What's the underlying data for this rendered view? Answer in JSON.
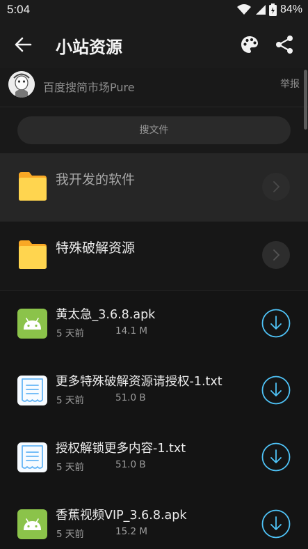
{
  "status_bar": {
    "time": "5:04",
    "battery": "84%"
  },
  "app_bar": {
    "title": "小站资源"
  },
  "owner": {
    "name": "百度搜简市场Pure",
    "report_label": "举报"
  },
  "search": {
    "label": "搜文件"
  },
  "folders": [
    {
      "name": "我开发的软件"
    },
    {
      "name": "特殊破解资源"
    }
  ],
  "files": [
    {
      "name": "黄太急_3.6.8.apk",
      "date": "5 天前",
      "size": "14.1 M",
      "type": "apk"
    },
    {
      "name": "更多特殊破解资源请授权-1.txt",
      "date": "5 天前",
      "size": "51.0 B",
      "type": "txt"
    },
    {
      "name": "授权解锁更多内容-1.txt",
      "date": "5 天前",
      "size": "51.0 B",
      "type": "txt"
    },
    {
      "name": "香蕉视频VIP_3.6.8.apk",
      "date": "5 天前",
      "size": "15.2 M",
      "type": "apk"
    }
  ],
  "colors": {
    "accent": "#4fc3f7",
    "apk_green": "#8bc34a",
    "folder_yellow": "#ffd54f",
    "txt_blue": "#64b5f6"
  }
}
